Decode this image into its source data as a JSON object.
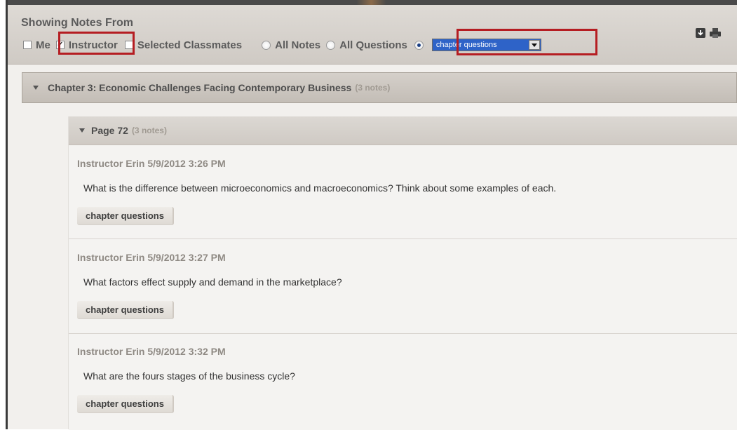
{
  "header": {
    "title": "Showing Notes From",
    "filters": [
      {
        "label": "Me",
        "type": "checkbox",
        "checked": false
      },
      {
        "label": "Instructor",
        "type": "checkbox",
        "checked": true
      },
      {
        "label": "Selected Classmates",
        "type": "checkbox",
        "checked": false
      },
      {
        "label": "All Notes",
        "type": "radio",
        "selected": false
      },
      {
        "label": "All Questions",
        "type": "radio",
        "selected": false
      },
      {
        "label": "",
        "type": "radio",
        "selected": true
      }
    ],
    "tag_select": {
      "value": "chapter questions"
    },
    "icons": [
      "download-icon",
      "print-icon"
    ]
  },
  "chapter": {
    "title": "Chapter 3: Economic Challenges Facing Contemporary Business",
    "count": "(3 notes)"
  },
  "page": {
    "title": "Page 72",
    "count": "(3 notes)"
  },
  "notes": [
    {
      "author": "Instructor Erin 5/9/2012 3:26 PM",
      "text": "What is the difference between microeconomics and macroeconomics? Think about some examples of each.",
      "tag": "chapter questions"
    },
    {
      "author": "Instructor Erin 5/9/2012 3:27 PM",
      "text": "What factors effect supply and demand in the marketplace?",
      "tag": "chapter questions"
    },
    {
      "author": "Instructor Erin 5/9/2012 3:32 PM",
      "text": "What are the fours stages of the business cycle?",
      "tag": "chapter questions"
    }
  ],
  "colors": {
    "highlight": "#b51d22",
    "select_bg": "#2e63c8",
    "author": "#8f8a84"
  }
}
